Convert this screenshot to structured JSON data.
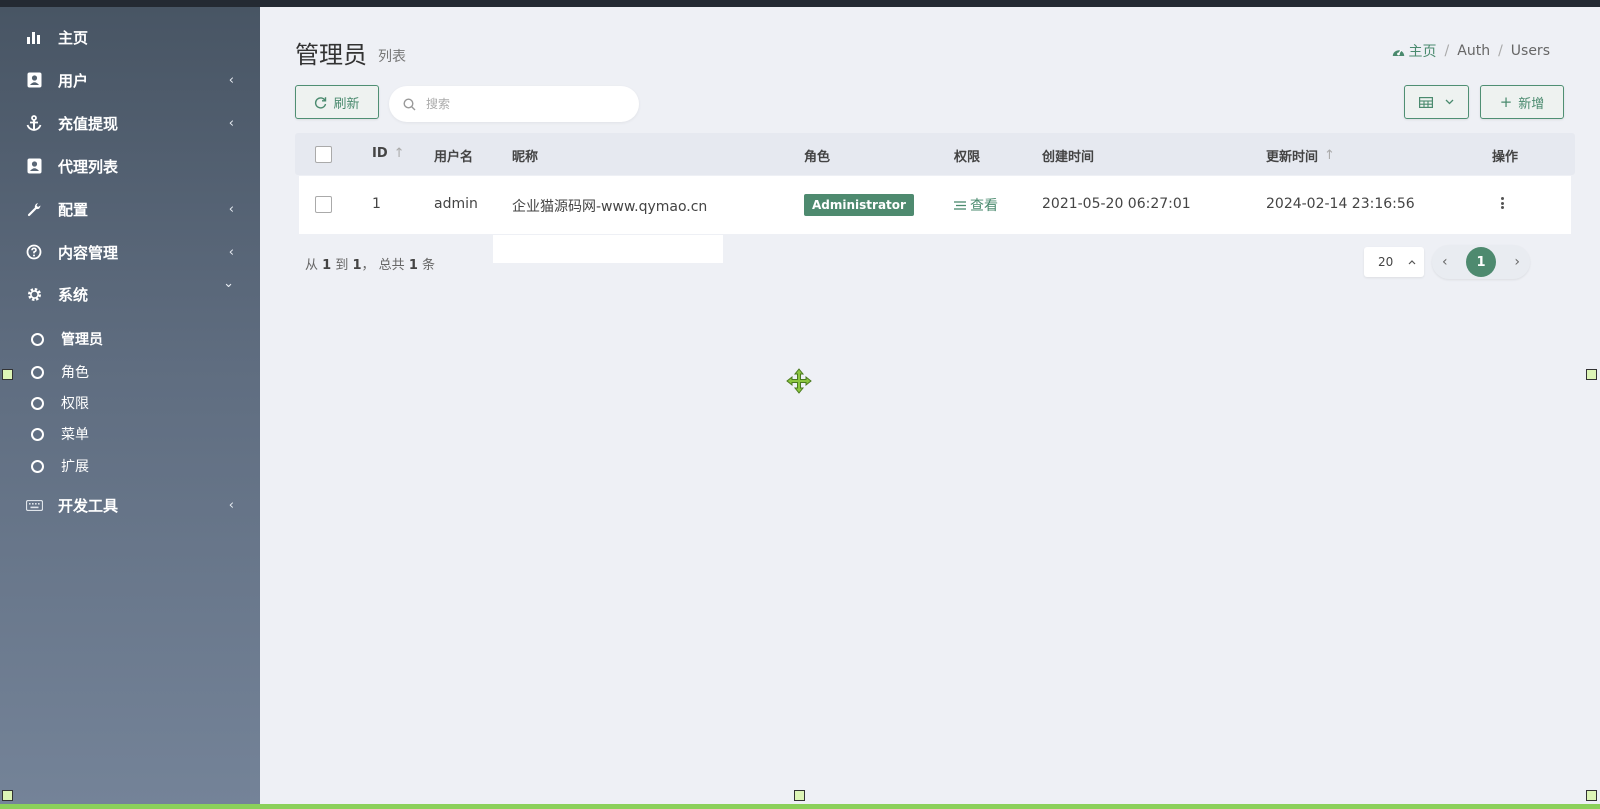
{
  "sidebar": {
    "items": [
      {
        "label": "主页",
        "icon": "bar-chart-icon",
        "arrow": ""
      },
      {
        "label": "用户",
        "icon": "user-card-icon",
        "arrow": "‹"
      },
      {
        "label": "充值提现",
        "icon": "anchor-icon",
        "arrow": "‹"
      },
      {
        "label": "代理列表",
        "icon": "user-card-icon",
        "arrow": ""
      },
      {
        "label": "配置",
        "icon": "wrench-icon",
        "arrow": "‹"
      },
      {
        "label": "内容管理",
        "icon": "help-circle-icon",
        "arrow": "‹"
      },
      {
        "label": "系统",
        "icon": "gear-icon",
        "arrow": "⌄"
      }
    ],
    "sub_items": [
      {
        "label": "管理员",
        "active": true
      },
      {
        "label": "角色"
      },
      {
        "label": "权限"
      },
      {
        "label": "菜单"
      },
      {
        "label": "扩展"
      }
    ],
    "dev_tools": {
      "label": "开发工具",
      "icon": "keyboard-icon",
      "arrow": "‹"
    }
  },
  "header": {
    "title": "管理员",
    "subtitle": "列表",
    "breadcrumb": [
      "主页",
      "Auth",
      "Users"
    ],
    "breadcrumb_sep": "/"
  },
  "toolbar": {
    "refresh_label": "刷新",
    "search_placeholder": "搜索",
    "new_label": "新增"
  },
  "table": {
    "columns": [
      "ID",
      "用户名",
      "昵称",
      "角色",
      "权限",
      "创建时间",
      "更新时间",
      "操作"
    ],
    "rows": [
      {
        "id": "1",
        "username": "admin",
        "nickname": "企业猫源码网-www.qymao.cn",
        "role": "Administrator",
        "permission": "查看",
        "created_at": "2021-05-20 06:27:01",
        "updated_at": "2024-02-14 23:16:56"
      }
    ]
  },
  "footer": {
    "summary_from": "从",
    "summary_start": "1",
    "summary_to": "到",
    "summary_end": "1",
    "summary_total_label": "， 总共",
    "summary_total": "1",
    "summary_unit": "条",
    "page_size": "20",
    "current_page": "1"
  },
  "colors": {
    "accent": "#4e8a6f",
    "sidebar_top": "#485564",
    "sidebar_bottom": "#748398",
    "background": "#eef0f5"
  }
}
